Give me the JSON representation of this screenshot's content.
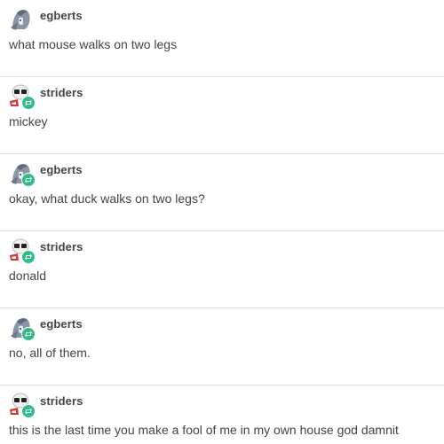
{
  "colors": {
    "text": "#444444",
    "divider": "#e2e2e2",
    "reblog_badge": "#2ebe86"
  },
  "posts": [
    {
      "username": "egberts",
      "message": "what mouse walks on two legs",
      "avatar_icon": "egberts-avatar-icon",
      "reblog": false
    },
    {
      "username": "striders",
      "message": "mickey",
      "avatar_icon": "striders-avatar-icon",
      "reblog": true
    },
    {
      "username": "egberts",
      "message": "okay, what duck walks on two legs?",
      "avatar_icon": "egberts-avatar-icon",
      "reblog": true
    },
    {
      "username": "striders",
      "message": "donald",
      "avatar_icon": "striders-avatar-icon",
      "reblog": true
    },
    {
      "username": "egberts",
      "message": "no, all of them.",
      "avatar_icon": "egberts-avatar-icon",
      "reblog": true
    },
    {
      "username": "striders",
      "message": "this is the last time you make a fool of me in my own house god damnit",
      "avatar_icon": "striders-avatar-icon",
      "reblog": true
    }
  ]
}
